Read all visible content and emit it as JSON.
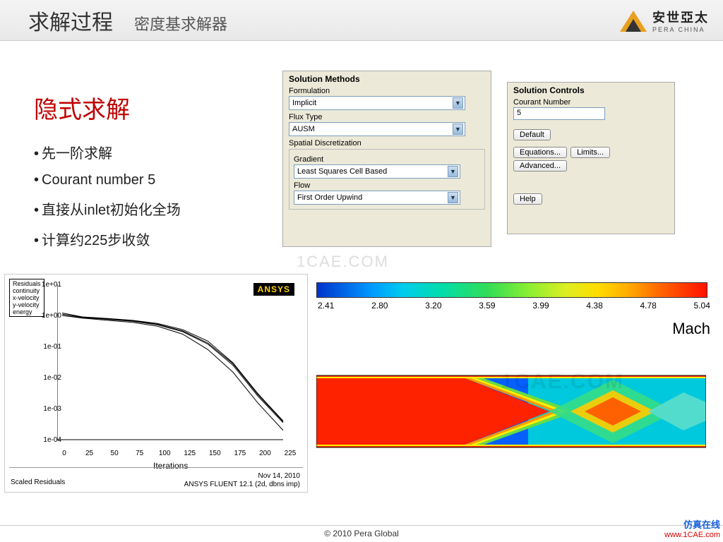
{
  "header": {
    "title_main": "求解过程",
    "title_sub": "密度基求解器",
    "logo_text": "安世亞太",
    "logo_sub": "PERA CHINA"
  },
  "left": {
    "heading": "隐式求解",
    "bullets": [
      "先一阶求解",
      "Courant number 5",
      "直接从inlet初始化全场",
      "计算约225步收敛"
    ]
  },
  "methods": {
    "panel_title": "Solution Methods",
    "formulation_label": "Formulation",
    "formulation_value": "Implicit",
    "flux_label": "Flux Type",
    "flux_value": "AUSM",
    "spatial_label": "Spatial Discretization",
    "gradient_label": "Gradient",
    "gradient_value": "Least Squares Cell Based",
    "flow_label": "Flow",
    "flow_value": "First Order Upwind"
  },
  "controls": {
    "panel_title": "Solution Controls",
    "courant_label": "Courant Number",
    "courant_value": "5",
    "default_btn": "Default",
    "equations_btn": "Equations...",
    "limits_btn": "Limits...",
    "advanced_btn": "Advanced...",
    "help_btn": "Help"
  },
  "residual": {
    "legend": [
      "Residuals",
      "continuity",
      "x-velocity",
      "y-velocity",
      "energy"
    ],
    "ansys": "ANSYS",
    "xlabel": "Iterations",
    "footer_left": "Scaled Residuals",
    "footer_date": "Nov 14, 2010",
    "footer_ver": "ANSYS FLUENT 12.1 (2d, dbns imp)"
  },
  "chart_data": {
    "type": "line",
    "title": "Scaled Residuals",
    "xlabel": "Iterations",
    "ylabel": "",
    "xlim": [
      0,
      225
    ],
    "ylim_log10": [
      -4,
      1
    ],
    "x_ticks": [
      0,
      25,
      50,
      75,
      100,
      125,
      150,
      175,
      200,
      225
    ],
    "y_ticks_labels": [
      "1e+01",
      "1e+00",
      "1e-01",
      "1e-02",
      "1e-03",
      "1e-04"
    ],
    "series": [
      {
        "name": "continuity",
        "x": [
          5,
          25,
          50,
          75,
          100,
          125,
          150,
          175,
          200,
          225
        ],
        "y": [
          1.2,
          0.9,
          0.8,
          0.7,
          0.55,
          0.35,
          0.15,
          0.03,
          0.003,
          0.0004
        ]
      },
      {
        "name": "x-velocity",
        "x": [
          5,
          25,
          50,
          75,
          100,
          125,
          150,
          175,
          200,
          225
        ],
        "y": [
          1.0,
          0.85,
          0.75,
          0.65,
          0.5,
          0.3,
          0.12,
          0.025,
          0.0025,
          0.00035
        ]
      },
      {
        "name": "y-velocity",
        "x": [
          5,
          25,
          50,
          75,
          100,
          125,
          150,
          175,
          200,
          225
        ],
        "y": [
          1.1,
          0.88,
          0.78,
          0.68,
          0.52,
          0.32,
          0.13,
          0.028,
          0.0028,
          0.00038
        ]
      },
      {
        "name": "energy",
        "x": [
          5,
          25,
          50,
          75,
          100,
          125,
          150,
          175,
          200,
          225
        ],
        "y": [
          1.0,
          0.82,
          0.7,
          0.6,
          0.45,
          0.25,
          0.08,
          0.015,
          0.0015,
          0.0002
        ]
      }
    ]
  },
  "colorbar": {
    "label": "Mach",
    "ticks": [
      "2.41",
      "2.80",
      "3.20",
      "3.59",
      "3.99",
      "4.38",
      "4.78",
      "5.04"
    ]
  },
  "footer": {
    "copyright": "© 2010 Pera Global"
  },
  "watermark": {
    "center": "1CAE.COM",
    "right_line1": "仿真在线",
    "right_line2": "www.1CAE.com",
    "cae": "1CAE.COM"
  }
}
